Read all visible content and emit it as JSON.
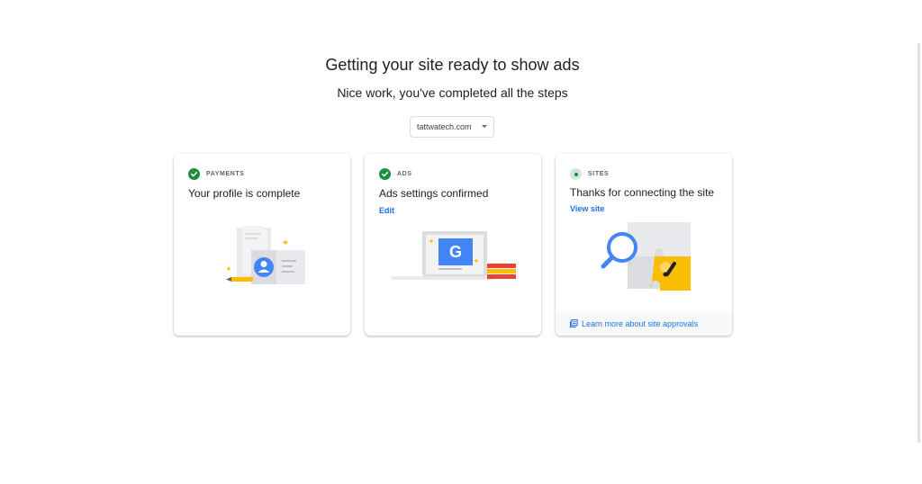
{
  "header": {
    "title": "Getting your site ready to show ads",
    "subtitle": "Nice work, you've completed all the steps"
  },
  "site_selector": {
    "value": "tattwatech.com",
    "icon": "dropdown-arrow-icon"
  },
  "cards": [
    {
      "label": "PAYMENTS",
      "status": "complete",
      "status_icon": "check-circle-icon",
      "title": "Your profile is complete",
      "illustration": "profile-document-illustration"
    },
    {
      "label": "ADS",
      "status": "complete",
      "status_icon": "check-circle-icon",
      "title": "Ads settings confirmed",
      "link": "Edit",
      "illustration": "laptop-google-illustration"
    },
    {
      "label": "SITES",
      "status": "in-progress",
      "status_icon": "pending-dot-icon",
      "title": "Thanks for connecting the site",
      "link": "View site",
      "illustration": "puzzle-magnifier-illustration",
      "footer_link": "Learn more about site approvals",
      "footer_icon": "external-doc-icon"
    }
  ],
  "colors": {
    "success_green": "#1e8e3e",
    "link_blue": "#1a73e8",
    "google_blue": "#4285f4",
    "google_yellow": "#fbbc04",
    "google_red": "#ea4335",
    "text_primary": "#202124",
    "text_secondary": "#5f6368"
  }
}
